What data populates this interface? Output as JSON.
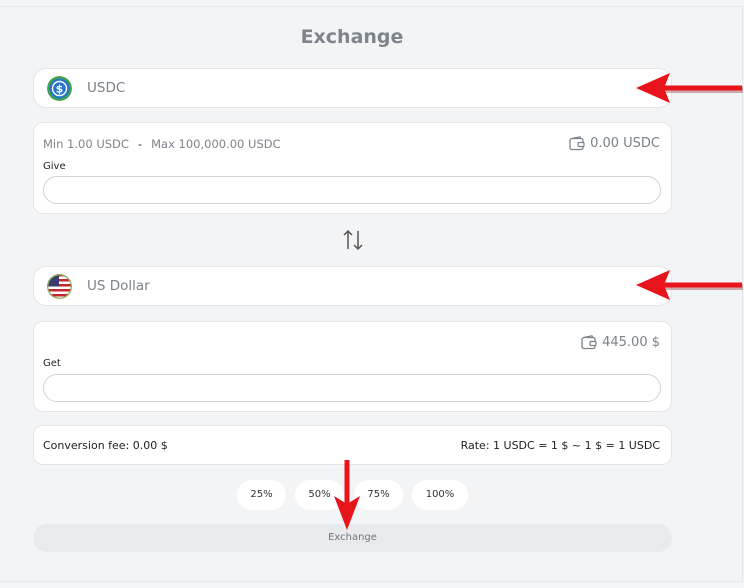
{
  "title": "Exchange",
  "from": {
    "currency": "USDC",
    "coin_icon": "usdc-coin-icon",
    "min_label": "Min 1.00 USDC",
    "separator": "-",
    "max_label": "Max 100,000.00 USDC",
    "balance": "0.00 USDC",
    "field_label": "Give",
    "input_value": "",
    "input_placeholder": ""
  },
  "to": {
    "currency": "US Dollar",
    "coin_icon": "us-flag-icon",
    "balance": "445.00 $",
    "field_label": "Get",
    "input_value": "",
    "input_placeholder": ""
  },
  "fee_label": "Conversion fee: 0.00 $",
  "rate_label": "Rate: 1 USDC = 1 $ ~ 1 $ = 1 USDC",
  "percent_buttons": [
    "25%",
    "50%",
    "75%",
    "100%"
  ],
  "exchange_button": "Exchange",
  "colors": {
    "annotation_arrow": "#e8141c",
    "usdc_blue": "#2775ca",
    "usdc_ring": "#3fa34d"
  }
}
